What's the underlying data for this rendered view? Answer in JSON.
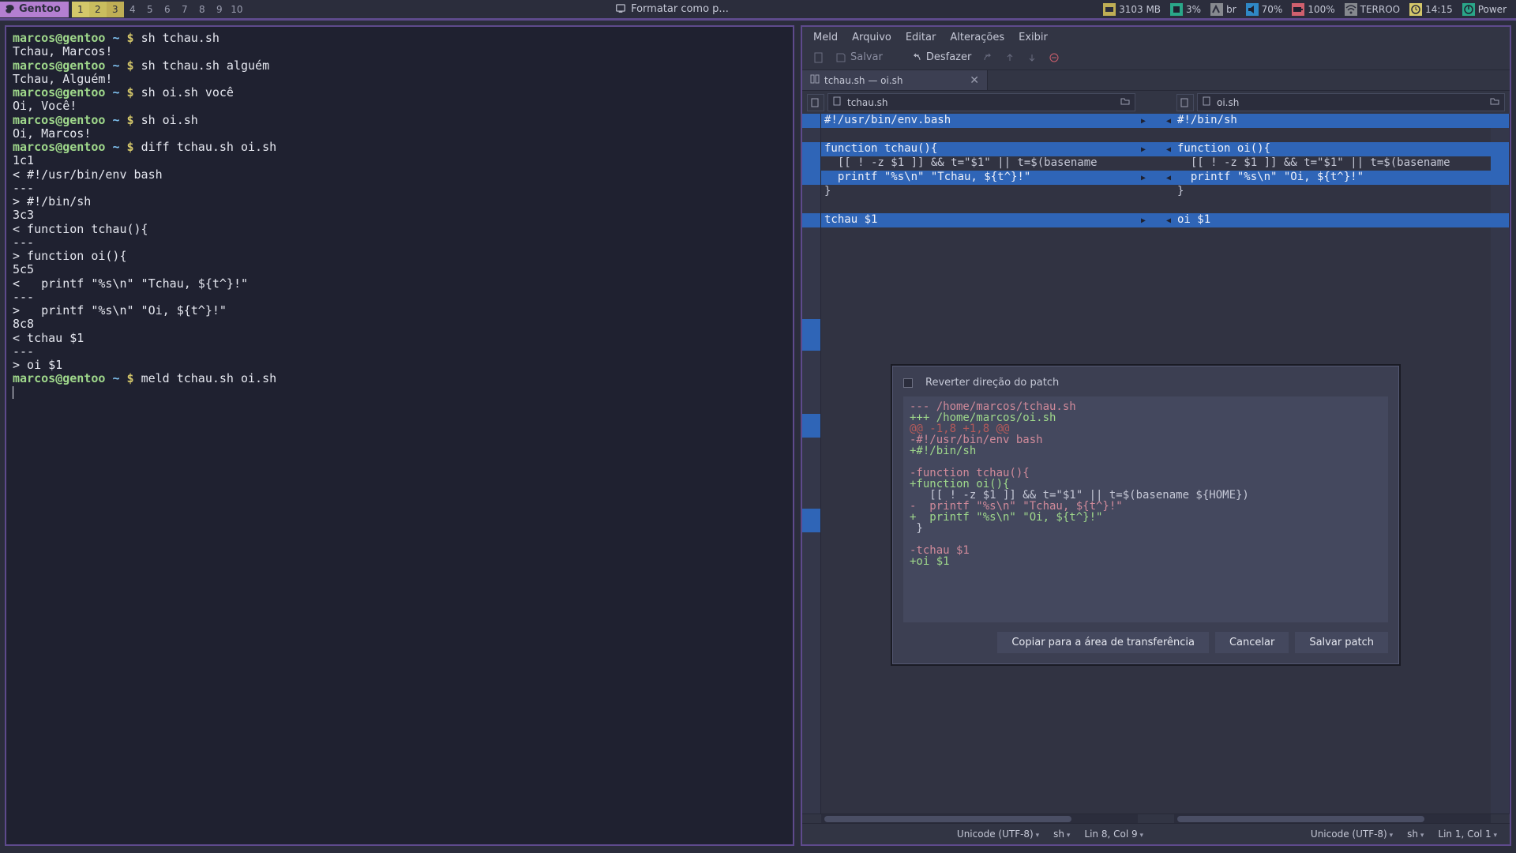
{
  "taskbar": {
    "brand": "Gentoo",
    "workspaces": [
      "1",
      "2",
      "3",
      "4",
      "5",
      "6",
      "7",
      "8",
      "9",
      "10"
    ],
    "active_workspaces": [
      0,
      1,
      2
    ],
    "center_title": "Formatar como p...",
    "tray": {
      "ram": "3103 MB",
      "cpu": "3%",
      "kb": "br",
      "vol": "70%",
      "bat": "100%",
      "wifi": "TERROO",
      "clock": "14:15",
      "power": "Power"
    }
  },
  "terminal": {
    "prompt_user": "marcos",
    "prompt_host": "gentoo",
    "prompt_path": "~",
    "lines": [
      {
        "t": "p",
        "cmd": "sh tchau.sh"
      },
      {
        "t": "o",
        "text": "Tchau, Marcos!"
      },
      {
        "t": "p",
        "cmd": "sh tchau.sh alguém"
      },
      {
        "t": "o",
        "text": "Tchau, Alguém!"
      },
      {
        "t": "p",
        "cmd": "sh oi.sh você"
      },
      {
        "t": "o",
        "text": "Oi, Você!"
      },
      {
        "t": "p",
        "cmd": "sh oi.sh"
      },
      {
        "t": "o",
        "text": "Oi, Marcos!"
      },
      {
        "t": "p",
        "cmd": "diff tchau.sh oi.sh"
      },
      {
        "t": "o",
        "text": "1c1"
      },
      {
        "t": "o",
        "text": "< #!/usr/bin/env bash"
      },
      {
        "t": "o",
        "text": "---"
      },
      {
        "t": "o",
        "text": "> #!/bin/sh"
      },
      {
        "t": "o",
        "text": "3c3"
      },
      {
        "t": "o",
        "text": "< function tchau(){"
      },
      {
        "t": "o",
        "text": "---"
      },
      {
        "t": "o",
        "text": "> function oi(){"
      },
      {
        "t": "o",
        "text": "5c5"
      },
      {
        "t": "o",
        "text": "<   printf \"%s\\n\" \"Tchau, ${t^}!\""
      },
      {
        "t": "o",
        "text": "---"
      },
      {
        "t": "o",
        "text": ">   printf \"%s\\n\" \"Oi, ${t^}!\""
      },
      {
        "t": "o",
        "text": "8c8"
      },
      {
        "t": "o",
        "text": "< tchau $1"
      },
      {
        "t": "o",
        "text": "---"
      },
      {
        "t": "o",
        "text": "> oi $1"
      },
      {
        "t": "p",
        "cmd": "meld tchau.sh oi.sh"
      }
    ]
  },
  "meld": {
    "menus": [
      "Meld",
      "Arquivo",
      "Editar",
      "Alterações",
      "Exibir"
    ],
    "toolbar": {
      "save": "Salvar",
      "undo": "Desfazer"
    },
    "tab_title": "tchau.sh — oi.sh",
    "left_file": "tchau.sh",
    "right_file": "oi.sh",
    "left_lines": [
      {
        "text": "#!/usr/bin/env.bash",
        "hl": true
      },
      {
        "text": "",
        "hl": false
      },
      {
        "text": "function tchau(){",
        "hl": true
      },
      {
        "text": "  [[ ! -z $1 ]] && t=\"$1\" || t=$(basename",
        "hl": false
      },
      {
        "text": "  printf \"%s\\n\" \"Tchau, ${t^}!\"",
        "hl": true
      },
      {
        "text": "}",
        "hl": false
      },
      {
        "text": "",
        "hl": false
      },
      {
        "text": "tchau $1",
        "hl": true
      }
    ],
    "right_lines": [
      {
        "text": "#!/bin/sh",
        "hl": true
      },
      {
        "text": "",
        "hl": false
      },
      {
        "text": "function oi(){",
        "hl": true
      },
      {
        "text": "  [[ ! -z $1 ]] && t=\"$1\" || t=$(basename",
        "hl": false
      },
      {
        "text": "  printf \"%s\\n\" \"Oi, ${t^}!\"",
        "hl": true
      },
      {
        "text": "}",
        "hl": false
      },
      {
        "text": "",
        "hl": false
      },
      {
        "text": "oi $1",
        "hl": true
      }
    ],
    "arrows": [
      true,
      false,
      true,
      false,
      true,
      false,
      false,
      true
    ],
    "status_left": {
      "encoding": "Unicode (UTF-8)",
      "lang": "sh",
      "pos": "Lin 8, Col 9"
    },
    "status_right": {
      "encoding": "Unicode (UTF-8)",
      "lang": "sh",
      "pos": "Lin 1, Col 1"
    },
    "dialog": {
      "checkbox_label": "Reverter direção do patch",
      "patch_lines": [
        {
          "c": "mn",
          "t": "--- /home/marcos/tchau.sh"
        },
        {
          "c": "pl",
          "t": "+++ /home/marcos/oi.sh"
        },
        {
          "c": "hh",
          "t": "@@ -1,8 +1,8 @@"
        },
        {
          "c": "mn",
          "t": "-#!/usr/bin/env bash"
        },
        {
          "c": "pl",
          "t": "+#!/bin/sh"
        },
        {
          "c": "nn",
          "t": " "
        },
        {
          "c": "mn",
          "t": "-function tchau(){"
        },
        {
          "c": "pl",
          "t": "+function oi(){"
        },
        {
          "c": "nn",
          "t": "   [[ ! -z $1 ]] && t=\"$1\" || t=$(basename ${HOME})"
        },
        {
          "c": "mn",
          "t": "-  printf \"%s\\n\" \"Tchau, ${t^}!\""
        },
        {
          "c": "pl",
          "t": "+  printf \"%s\\n\" \"Oi, ${t^}!\""
        },
        {
          "c": "nn",
          "t": " }"
        },
        {
          "c": "nn",
          "t": " "
        },
        {
          "c": "mn",
          "t": "-tchau $1"
        },
        {
          "c": "pl",
          "t": "+oi $1"
        }
      ],
      "btn_copy": "Copiar para a área de transferência",
      "btn_cancel": "Cancelar",
      "btn_save": "Salvar patch"
    }
  }
}
